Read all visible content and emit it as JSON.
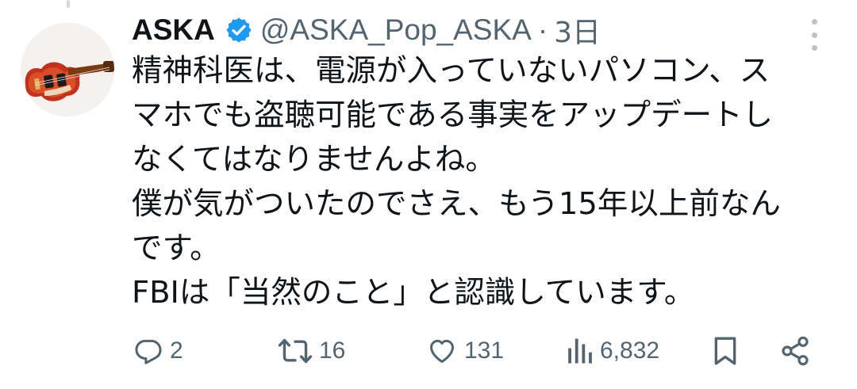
{
  "tweet": {
    "author": {
      "name": "ASKA",
      "handle": "@ASKA_Pop_ASKA",
      "verified": true,
      "avatar": "violin-bass-guitar"
    },
    "separator": "·",
    "timestamp": "3日",
    "text_lines": [
      "精神科医は、電源が入っていないパソコン、ス",
      "マホでも盗聴可能である事実をアップデートし",
      "なくてはなりませんよね。",
      "僕が気がついたのでさえ、もう15年以上前なん",
      "です。",
      "FBIは「当然のこと」と認識しています。"
    ],
    "metrics": {
      "replies": "2",
      "reposts": "16",
      "likes": "131",
      "views": "6,832"
    },
    "icons": {
      "reply": "reply-icon",
      "repost": "repost-icon",
      "like": "heart-icon",
      "views": "views-icon",
      "bookmark": "bookmark-icon",
      "share": "share-icon",
      "more": "more-options-icon",
      "verified": "verified-badge-icon"
    },
    "colors": {
      "text": "#0f1419",
      "secondary": "#536471",
      "verified": "#1d9bf0"
    }
  }
}
